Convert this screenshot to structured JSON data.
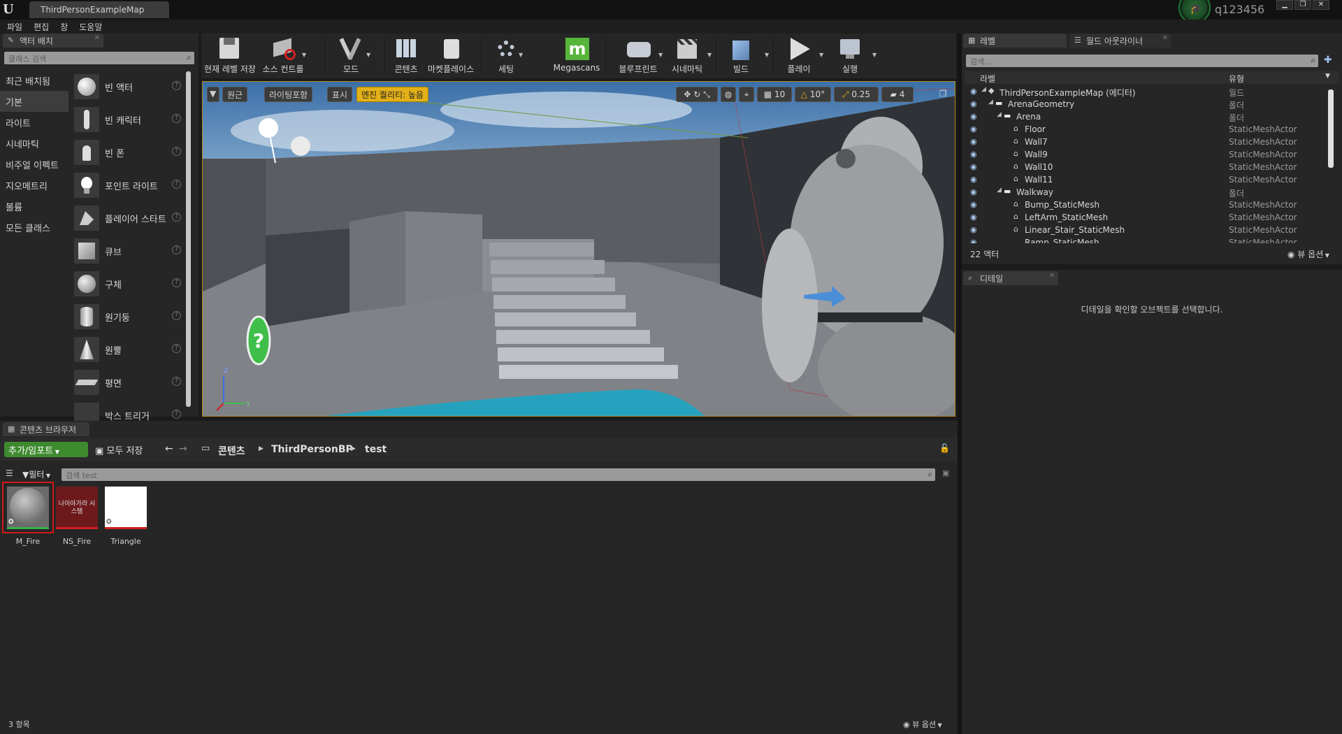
{
  "window": {
    "tab_title": "ThirdPersonExampleMap",
    "user_name": "q123456"
  },
  "menu": [
    "파일",
    "편집",
    "창",
    "도움말"
  ],
  "place_actors": {
    "tab_label": "액터 배치",
    "search_placeholder": "클래스 검색",
    "categories": [
      "최근 배치됨",
      "기본",
      "라이트",
      "시네마틱",
      "비주얼 이펙트",
      "지오메트리",
      "볼륨",
      "모든 클래스"
    ],
    "active_category": "기본",
    "items": [
      "빈 액터",
      "빈 캐릭터",
      "빈 폰",
      "포인트 라이트",
      "플레이어 스타트",
      "큐브",
      "구체",
      "원기둥",
      "원뿔",
      "평면",
      "박스 트리거"
    ]
  },
  "toolbar": {
    "save": "현재 레벨 저장",
    "source_control": "소스 컨트롤",
    "modes": "모드",
    "content": "콘텐츠",
    "marketplace": "마켓플레이스",
    "settings": "세팅",
    "megascans": "Megascans",
    "blueprints": "블루프린트",
    "cinematics": "시네마틱",
    "build": "빌드",
    "play": "플레이",
    "launch": "실행"
  },
  "viewport": {
    "perspective": "원근",
    "lit": "라이팅포함",
    "show": "표시",
    "quality": "엔진 퀄리티: 높음",
    "grid_snap": "10",
    "rot_snap": "10°",
    "scale_snap": "0.25",
    "cam_speed": "4",
    "axis_z": "Z",
    "axis_y": "Y"
  },
  "outliner": {
    "tab_levels": "레벨",
    "tab_outliner": "월드 아웃라이너",
    "search_placeholder": "검색...",
    "col_label": "라벨",
    "col_type": "유형",
    "rows": [
      {
        "name": "ThirdPersonExampleMap (에디터)",
        "type": "월드"
      },
      {
        "name": "ArenaGeometry",
        "type": "폴더"
      },
      {
        "name": "Arena",
        "type": "폴더"
      },
      {
        "name": "Floor",
        "type": "StaticMeshActor"
      },
      {
        "name": "Wall7",
        "type": "StaticMeshActor"
      },
      {
        "name": "Wall9",
        "type": "StaticMeshActor"
      },
      {
        "name": "Wall10",
        "type": "StaticMeshActor"
      },
      {
        "name": "Wall11",
        "type": "StaticMeshActor"
      },
      {
        "name": "Walkway",
        "type": "폴더"
      },
      {
        "name": "Bump_StaticMesh",
        "type": "StaticMeshActor"
      },
      {
        "name": "LeftArm_StaticMesh",
        "type": "StaticMeshActor"
      },
      {
        "name": "Linear_Stair_StaticMesh",
        "type": "StaticMeshActor"
      },
      {
        "name": "Ramp_StaticMesh",
        "type": "StaticMeshActor"
      }
    ],
    "actor_count": "22 액터",
    "view_options": "뷰 옵션"
  },
  "details": {
    "tab_label": "디테일",
    "empty_message": "디테일을 확인할 오브젝트를 선택합니다."
  },
  "content_browser": {
    "tab_label": "콘텐츠 브라우저",
    "add_import": "추가/임포트",
    "save_all": "모두 저장",
    "path": [
      "콘텐츠",
      "ThirdPersonBP",
      "test"
    ],
    "filter": "필터",
    "search_placeholder": "검색 test",
    "assets": [
      {
        "name": "M_Fire",
        "thumb_text": ""
      },
      {
        "name": "NS_Fire",
        "thumb_text": "나이아가라 시스템"
      },
      {
        "name": "Triangle",
        "thumb_text": ""
      }
    ],
    "item_count": "3 항목",
    "view_options": "뷰 옵션"
  },
  "colors": {
    "accent_green": "#3e8a2f",
    "selection_red": "#d01818",
    "viewport_border": "#b28a1a",
    "quality_yellow": "#e3b017"
  }
}
